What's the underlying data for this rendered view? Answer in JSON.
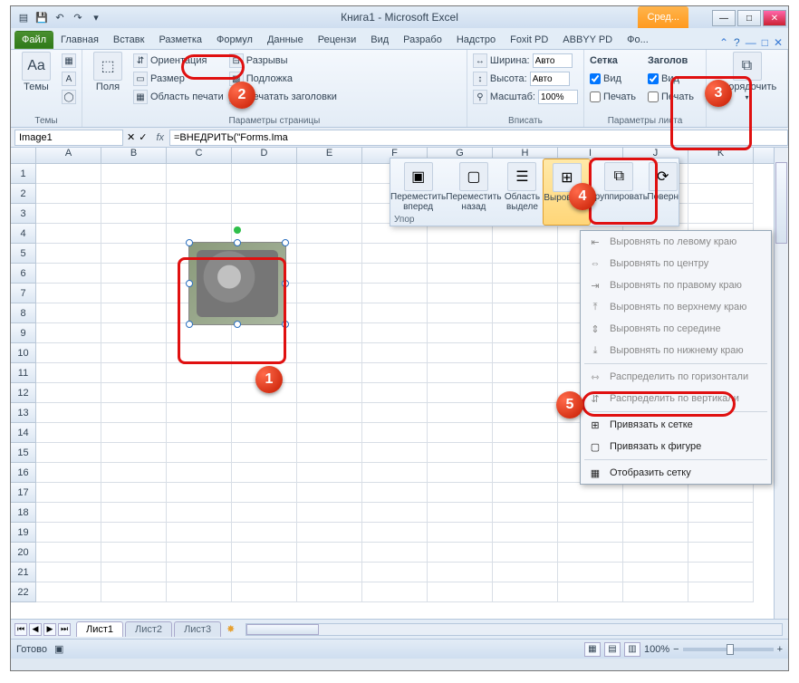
{
  "title": "Книга1 - Microsoft Excel",
  "context_tab": "Сред...",
  "tabs": {
    "file": "Файл",
    "items": [
      "Главная",
      "Вставк",
      "Разметка",
      "Формул",
      "Данные",
      "Рецензи",
      "Вид",
      "Разрабо",
      "Надстро",
      "Foxit PD",
      "ABBYY PD",
      "Фо..."
    ]
  },
  "ribbon": {
    "themes": {
      "big": "Темы",
      "title": "Темы"
    },
    "page": {
      "big": "Поля",
      "rows": [
        "Ориентация",
        "Размер",
        "Область печати"
      ],
      "rows2": [
        "Разрывы",
        "Подложка",
        "Печатать заголовки"
      ],
      "title": "Параметры страницы"
    },
    "fit": {
      "w": "Ширина:",
      "h": "Высота:",
      "s": "Масштаб:",
      "wa": "Авто",
      "ha": "Авто",
      "sv": "100%",
      "title": "Вписать"
    },
    "sheet": {
      "grid": "Сетка",
      "head": "Заголов",
      "view": "Вид",
      "print": "Печать",
      "title": "Параметры листа"
    },
    "arrange": {
      "label": "Упорядочить"
    }
  },
  "fbar": {
    "name": "Image1",
    "formula": "=ВНЕДРИТЬ(\"Forms.Ima"
  },
  "arrange_popup": {
    "items": [
      "Переместить вперед",
      "Переместить назад",
      "Область выделе",
      "Выровнять",
      "Группировать",
      "Поверн"
    ],
    "group": "Упор"
  },
  "align_menu": {
    "items": [
      "Выровнять по левому краю",
      "Выровнять по центру",
      "Выровнять по правому краю",
      "Выровнять по верхнему краю",
      "Выровнять по середине",
      "Выровнять по нижнему краю",
      "Распределить по горизонтали",
      "Распределить по вертикали",
      "Привязать к сетке",
      "Привязать к фигуре",
      "Отобразить сетку"
    ]
  },
  "cols": [
    "A",
    "B",
    "C",
    "D",
    "E",
    "F",
    "G",
    "H",
    "I",
    "J",
    "K"
  ],
  "rows": 22,
  "sheets": {
    "active": "Лист1",
    "others": [
      "Лист2",
      "Лист3"
    ]
  },
  "status": {
    "ready": "Готово",
    "zoom": "100%"
  },
  "badges": {
    "1": "1",
    "2": "2",
    "3": "3",
    "4": "4",
    "5": "5"
  }
}
